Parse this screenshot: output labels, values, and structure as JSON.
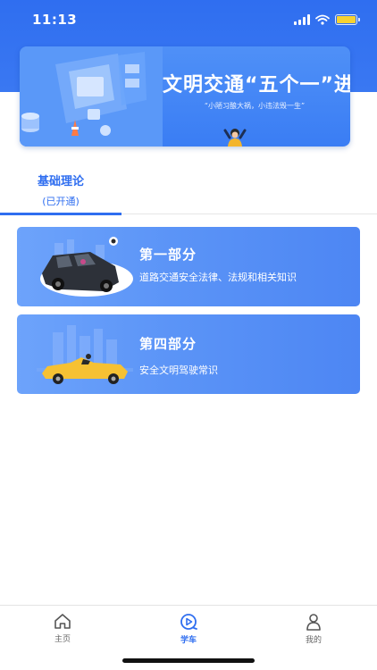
{
  "status_bar": {
    "time": "11:13"
  },
  "banner": {
    "title": "文明交通“五个一”进驾校",
    "subtitle": "“小陋习酿大祸，小违法毁一生”"
  },
  "tabs": [
    {
      "title": "基础理论",
      "status": "(已开通)",
      "active": true
    }
  ],
  "courses": [
    {
      "title": "第一部分",
      "description": "道路交通安全法律、法规和相关知识"
    },
    {
      "title": "第四部分",
      "description": "安全文明驾驶常识"
    }
  ],
  "bottom_nav": [
    {
      "label": "主页",
      "icon": "home-icon",
      "active": false
    },
    {
      "label": "学车",
      "icon": "play-circle-icon",
      "active": true
    },
    {
      "label": "我的",
      "icon": "user-icon",
      "active": false
    }
  ],
  "colors": {
    "primary": "#2f6ef0",
    "card_gradient_start": "#6da3fb",
    "card_gradient_end": "#4d86f3"
  }
}
